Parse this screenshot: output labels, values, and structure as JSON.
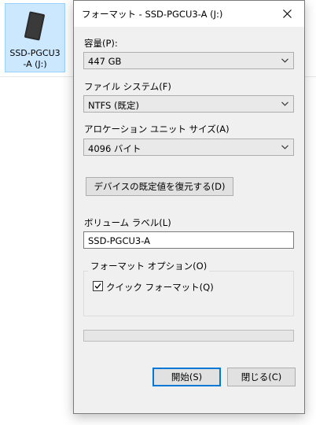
{
  "desktop": {
    "drive_label": "SSD-PGCU3\n-A (J:)",
    "drive_icon": "external-ssd-icon"
  },
  "dialog": {
    "title": "フォーマット - SSD-PGCU3-A (J:)",
    "close_icon": "close-icon",
    "capacity": {
      "label": "容量(P):",
      "value": "447 GB"
    },
    "filesystem": {
      "label": "ファイル システム(F)",
      "value": "NTFS (既定)"
    },
    "allocation": {
      "label": "アロケーション ユニット サイズ(A)",
      "value": "4096 バイト"
    },
    "restore_defaults_label": "デバイスの既定値を復元する(D)",
    "volume_label": {
      "label": "ボリューム ラベル(L)",
      "value": "SSD-PGCU3-A"
    },
    "format_options": {
      "title": "フォーマット オプション(O)",
      "quick_format_label": "クイック フォーマット(Q)",
      "quick_format_checked": true
    },
    "progress_fraction": 0,
    "start_label": "開始(S)",
    "close_label": "閉じる(C)"
  },
  "colors": {
    "accent": "#0078d7",
    "dialog_bg": "#f0f0f0",
    "selection_bg": "#cce8ff"
  }
}
